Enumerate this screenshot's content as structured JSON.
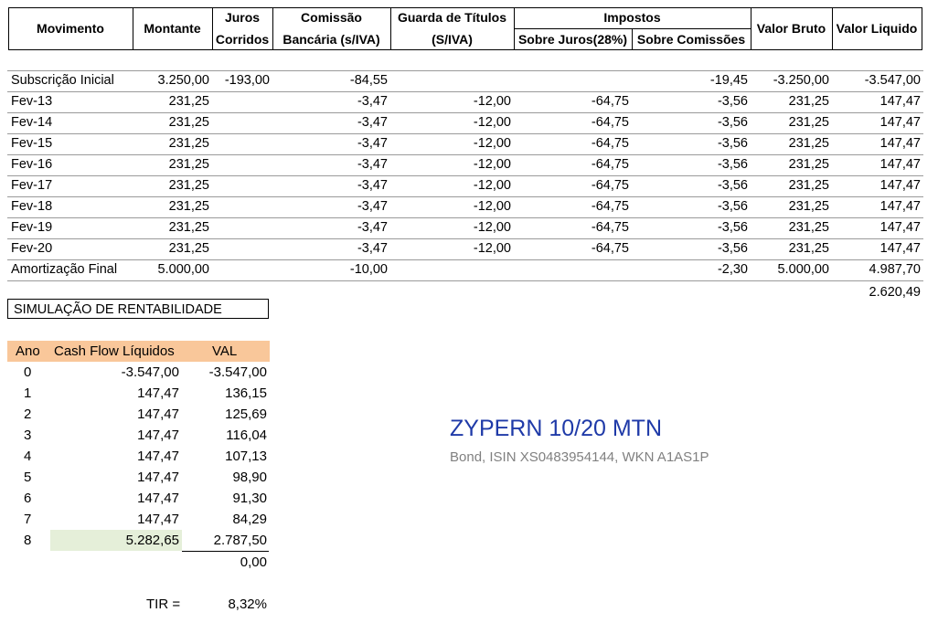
{
  "header": {
    "movimento": "Movimento",
    "montante": "Montante",
    "juros_l1": "Juros",
    "juros_l2": "Corridos",
    "comissao_l1": "Comissão",
    "comissao_l2": "Bancária (s/IVA)",
    "guarda_l1": "Guarda de Títulos",
    "guarda_l2": "(S/IVA)",
    "impostos": "Impostos",
    "sobre_juros": "Sobre Juros(28%)",
    "sobre_comissoes": "Sobre Comissões",
    "valor_bruto": "Valor Bruto",
    "valor_liquido": "Valor Liquido"
  },
  "rows": [
    {
      "mov": "Subscrição Inicial",
      "montante": "3.250,00",
      "juros": "-193,00",
      "comissao": "-84,55",
      "guarda": "",
      "imp_juros": "",
      "imp_com": "-19,45",
      "bruto": "-3.250,00",
      "liquido": "-3.547,00"
    },
    {
      "mov": "Fev-13",
      "montante": "231,25",
      "juros": "",
      "comissao": "-3,47",
      "guarda": "-12,00",
      "imp_juros": "-64,75",
      "imp_com": "-3,56",
      "bruto": "231,25",
      "liquido": "147,47"
    },
    {
      "mov": "Fev-14",
      "montante": "231,25",
      "juros": "",
      "comissao": "-3,47",
      "guarda": "-12,00",
      "imp_juros": "-64,75",
      "imp_com": "-3,56",
      "bruto": "231,25",
      "liquido": "147,47"
    },
    {
      "mov": "Fev-15",
      "montante": "231,25",
      "juros": "",
      "comissao": "-3,47",
      "guarda": "-12,00",
      "imp_juros": "-64,75",
      "imp_com": "-3,56",
      "bruto": "231,25",
      "liquido": "147,47"
    },
    {
      "mov": "Fev-16",
      "montante": "231,25",
      "juros": "",
      "comissao": "-3,47",
      "guarda": "-12,00",
      "imp_juros": "-64,75",
      "imp_com": "-3,56",
      "bruto": "231,25",
      "liquido": "147,47"
    },
    {
      "mov": "Fev-17",
      "montante": "231,25",
      "juros": "",
      "comissao": "-3,47",
      "guarda": "-12,00",
      "imp_juros": "-64,75",
      "imp_com": "-3,56",
      "bruto": "231,25",
      "liquido": "147,47"
    },
    {
      "mov": "Fev-18",
      "montante": "231,25",
      "juros": "",
      "comissao": "-3,47",
      "guarda": "-12,00",
      "imp_juros": "-64,75",
      "imp_com": "-3,56",
      "bruto": "231,25",
      "liquido": "147,47"
    },
    {
      "mov": "Fev-19",
      "montante": "231,25",
      "juros": "",
      "comissao": "-3,47",
      "guarda": "-12,00",
      "imp_juros": "-64,75",
      "imp_com": "-3,56",
      "bruto": "231,25",
      "liquido": "147,47"
    },
    {
      "mov": "Fev-20",
      "montante": "231,25",
      "juros": "",
      "comissao": "-3,47",
      "guarda": "-12,00",
      "imp_juros": "-64,75",
      "imp_com": "-3,56",
      "bruto": "231,25",
      "liquido": "147,47"
    },
    {
      "mov": "Amortização Final",
      "montante": "5.000,00",
      "juros": "",
      "comissao": "-10,00",
      "guarda": "",
      "imp_juros": "",
      "imp_com": "-2,30",
      "bruto": "5.000,00",
      "liquido": "4.987,70"
    }
  ],
  "total_liquido": "2.620,49",
  "simulation": {
    "title": "SIMULAÇÃO DE RENTABILIDADE",
    "col_ano": "Ano",
    "col_cash": "Cash Flow Líquidos",
    "col_val": "VAL",
    "rows": [
      {
        "ano": "0",
        "cash": "-3.547,00",
        "val": "-3.547,00"
      },
      {
        "ano": "1",
        "cash": "147,47",
        "val": "136,15"
      },
      {
        "ano": "2",
        "cash": "147,47",
        "val": "125,69"
      },
      {
        "ano": "3",
        "cash": "147,47",
        "val": "116,04"
      },
      {
        "ano": "4",
        "cash": "147,47",
        "val": "107,13"
      },
      {
        "ano": "5",
        "cash": "147,47",
        "val": "98,90"
      },
      {
        "ano": "6",
        "cash": "147,47",
        "val": "91,30"
      },
      {
        "ano": "7",
        "cash": "147,47",
        "val": "84,29"
      },
      {
        "ano": "8",
        "cash": "5.282,65",
        "val": "2.787,50"
      }
    ],
    "val_total": "0,00",
    "tir_label": "TIR =",
    "tir_value": "8,32%"
  },
  "bond": {
    "title": "ZYPERN 10/20 MTN",
    "subtitle": "Bond, ISIN XS0483954144, WKN A1AS1P"
  },
  "colors": {
    "header_fill": "#f9c79a",
    "highlight_fill": "#e5efd9",
    "bond_title": "#1f3aa8",
    "bond_subtitle": "#808080"
  }
}
